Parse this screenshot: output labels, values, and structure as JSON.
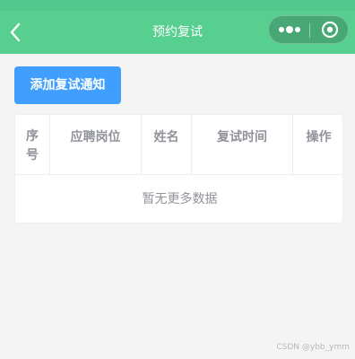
{
  "navbar": {
    "title": "预约复试",
    "back_icon": "chevron-left-icon",
    "more_icon": "more-dots-icon",
    "close_icon": "target-close-icon",
    "bg_color": "#56cf8f"
  },
  "toolbar": {
    "add_label": "添加复试通知",
    "accent": "#409eff"
  },
  "table": {
    "columns": [
      "序号",
      "应聘岗位",
      "姓名",
      "复试时间",
      "操作"
    ],
    "empty_text": "暂无更多数据"
  },
  "watermark": "CSDN @ybb_ymm"
}
